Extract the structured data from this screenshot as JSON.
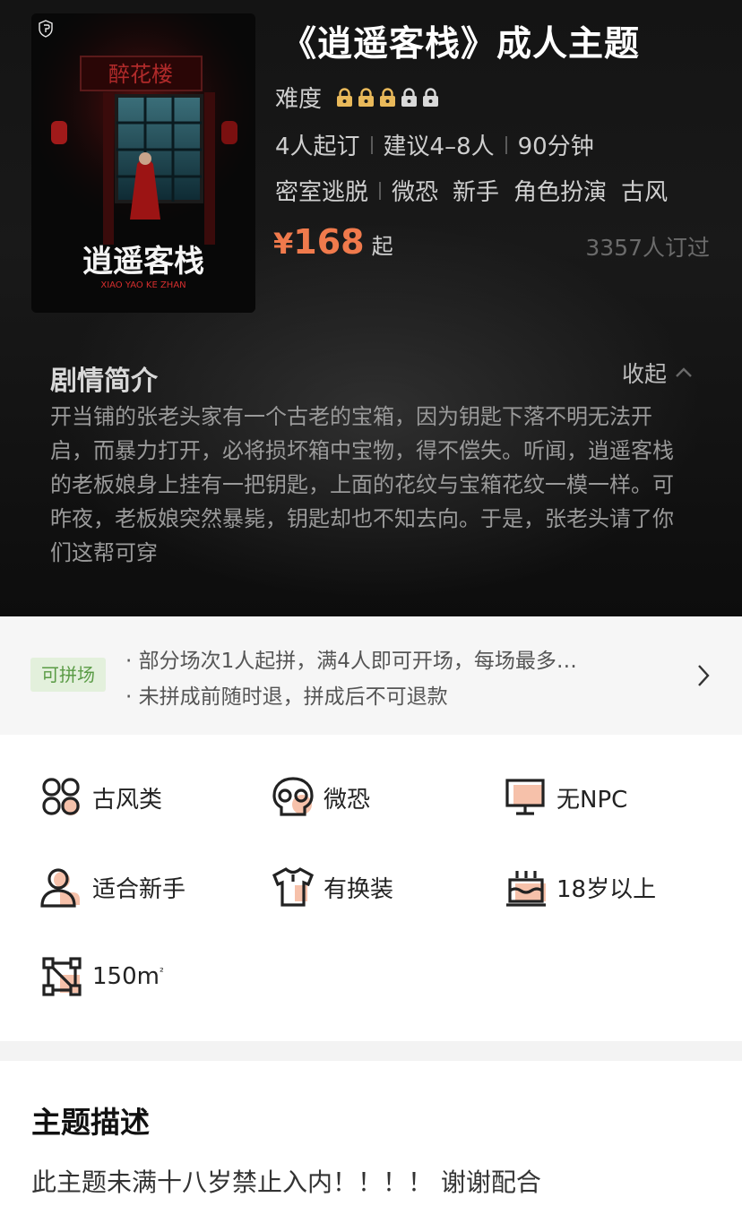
{
  "poster": {
    "title": "逍遥客栈",
    "subtitle": "XIAO YAO KE ZHAN",
    "signboard": "醉花楼"
  },
  "header": {
    "title": "《逍遥客栈》成人主题",
    "difficulty_label": "难度",
    "difficulty": {
      "value": 3,
      "max": 5
    },
    "info": [
      "4人起订",
      "建议4–8人",
      "90分钟"
    ],
    "tags_first": "密室逃脱",
    "tags": [
      "微恐",
      "新手",
      "角色扮演",
      "古风"
    ],
    "price_currency": "¥",
    "price": "168",
    "price_suffix": "起",
    "booked": "3357人订过"
  },
  "synopsis": {
    "title": "剧情简介",
    "collapse_label": "收起",
    "text": "开当铺的张老头家有一个古老的宝箱，因为钥匙下落不明无法开启，而暴力打开，必将损坏箱中宝物，得不偿失。听闻，逍遥客栈的老板娘身上挂有一把钥匙，上面的花纹与宝箱花纹一模一样。可昨夜，老板娘突然暴毙，钥匙却也不知去向。于是，张老头请了你们这帮可穿"
  },
  "group": {
    "badge": "可拼场",
    "lines": [
      "· 部分场次1人起拼，满4人即可开场，每场最多…",
      "· 未拼成前随时退，拼成后不可退款"
    ]
  },
  "features": [
    {
      "icon": "style-grid-icon",
      "label": "古风类"
    },
    {
      "icon": "skull-icon",
      "label": "微恐"
    },
    {
      "icon": "monitor-icon",
      "label": "无NPC"
    },
    {
      "icon": "person-icon",
      "label": "适合新手"
    },
    {
      "icon": "shirt-icon",
      "label": "有换装"
    },
    {
      "icon": "cake-icon",
      "label": "18岁以上"
    },
    {
      "icon": "area-icon",
      "label": "150m",
      "label_sup": "²"
    }
  ],
  "theme_desc": {
    "title": "主题描述",
    "text": "此主题未满十八岁禁止入内！！！！ 谢谢配合"
  },
  "colors": {
    "accent": "#f07a4c",
    "lock_active": "#e9b95a",
    "lock_inactive": "#d9d9d9",
    "badge_bg": "#e3f0dc",
    "badge_text": "#5a9b45",
    "dark_bg": "#141414"
  }
}
